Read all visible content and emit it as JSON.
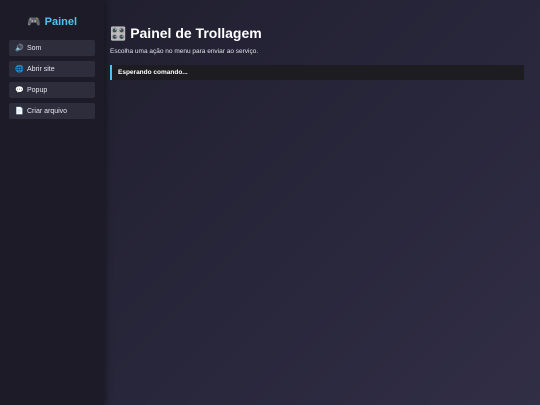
{
  "sidebar": {
    "brand": {
      "icon": "🎮",
      "icon_name": "gamepad-icon",
      "label": "Painel"
    },
    "items": [
      {
        "icon": "🔊",
        "icon_name": "speaker-icon",
        "label": "Som"
      },
      {
        "icon": "🌐",
        "icon_name": "globe-icon",
        "label": "Abrir site"
      },
      {
        "icon": "💬",
        "icon_name": "speech-bubble-icon",
        "label": "Popup"
      },
      {
        "icon": "📄",
        "icon_name": "document-icon",
        "label": "Criar arquivo"
      }
    ]
  },
  "main": {
    "title_icon": "🎛️",
    "title_icon_name": "control-knobs-icon",
    "title": "Painel de Trollagem",
    "subtitle": "Escolha uma ação no menu para enviar ao serviço.",
    "status": "Esperando comando..."
  },
  "colors": {
    "accent": "#4dc3f0",
    "sidebar_bg": "#1c1b27",
    "menu_item_bg": "#2e2d3c",
    "status_bg": "#1c1c21"
  }
}
